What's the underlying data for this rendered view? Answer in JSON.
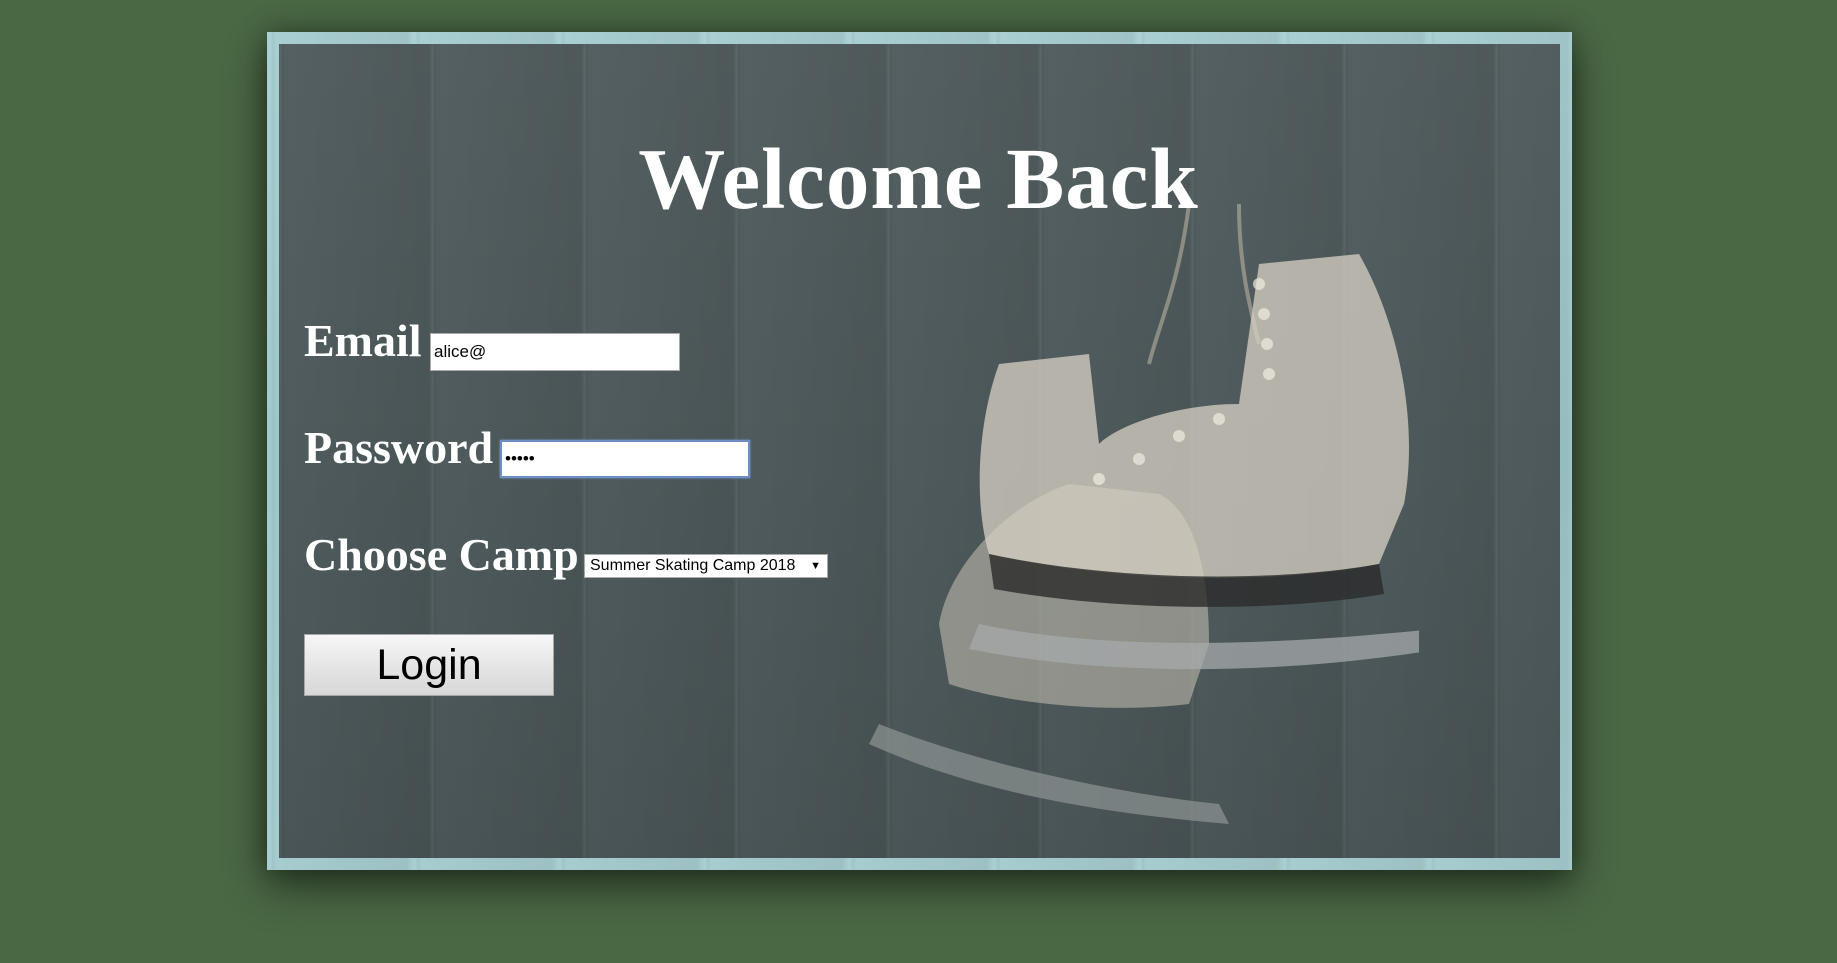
{
  "page": {
    "title": "Welcome Back"
  },
  "form": {
    "email_label": "Email",
    "email_value": "alice@",
    "password_label": "Password",
    "password_value": "•••••",
    "camp_label": "Choose Camp",
    "camp_selected": "Summer Skating Camp 2018",
    "login_label": "Login"
  },
  "icons": {
    "dropdown": "chevron-down-icon"
  },
  "colors": {
    "page_background": "#4a6844",
    "panel_overlay": "#4e5a5c",
    "frame": "#b9dadc",
    "text": "#ffffff",
    "focus_ring": "#6f8ec6"
  }
}
